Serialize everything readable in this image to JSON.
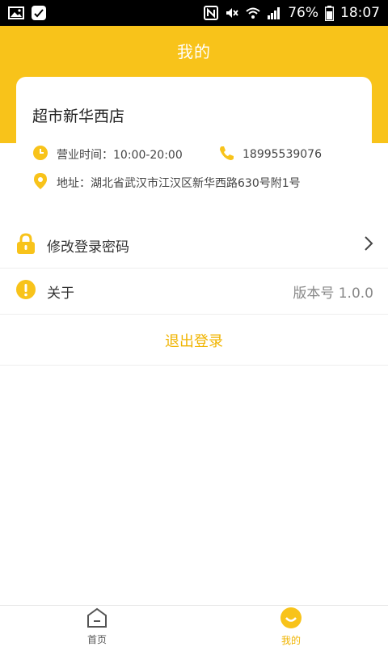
{
  "status_bar": {
    "battery": "76%",
    "time": "18:07"
  },
  "header": {
    "title": "我的"
  },
  "shop": {
    "name": "超市新华西店",
    "hours": "营业时间：10:00-20:00",
    "phone": "18995539076",
    "address": "地址：湖北省武汉市江汉区新华西路630号附1号"
  },
  "menu": {
    "change_password": "修改登录密码",
    "about": "关于",
    "version": "版本号 1.0.0"
  },
  "logout_label": "退出登录",
  "tabs": {
    "home": "首页",
    "mine": "我的"
  },
  "colors": {
    "accent": "#f8c31a",
    "accent_text": "#f0b400"
  }
}
